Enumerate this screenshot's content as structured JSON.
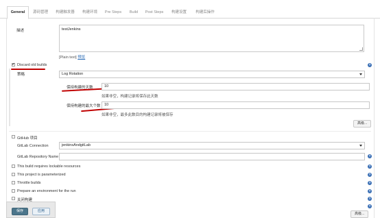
{
  "tabs": [
    "General",
    "源码管理",
    "构建触发器",
    "构建环境",
    "Pre Steps",
    "Build",
    "Post Steps",
    "构建设置",
    "构建后操作"
  ],
  "description": {
    "label": "描述",
    "value": "testJenkins",
    "plain_text": "[Plain text]",
    "preview_link": "预览"
  },
  "discard": {
    "label": "Discard old builds",
    "checked": true,
    "strategy_label": "策略",
    "strategy_value": "Log Rotation",
    "days_label": "保持构建的天数",
    "days_value": "10",
    "days_hint": "如果非空，构建记录将保存此天数",
    "max_label": "保持构建的最大个数",
    "max_value": "10",
    "max_hint": "如果非空，最多此数目的构建记录将被保存",
    "advanced_button": "高级..."
  },
  "gitlab": {
    "github_project_label": "GitHub 项目",
    "connection_label": "GitLab Connection",
    "connection_value": "jenkinsAndgitLab",
    "repo_label": "GitLab Repository Name",
    "repo_value": ""
  },
  "options": [
    "This build requires lockable resources",
    "This project is parameterized",
    "Throttle builds",
    "Prepare an environment for the run",
    "关闭构建"
  ],
  "bottom": {
    "save_label": "保存",
    "apply_label": "应用",
    "advanced_button": "高级..."
  },
  "help_glyph": "?",
  "colors": {
    "accent": "#4b758b",
    "help": "#3a6fb5",
    "annotation_red": "#c00000"
  }
}
